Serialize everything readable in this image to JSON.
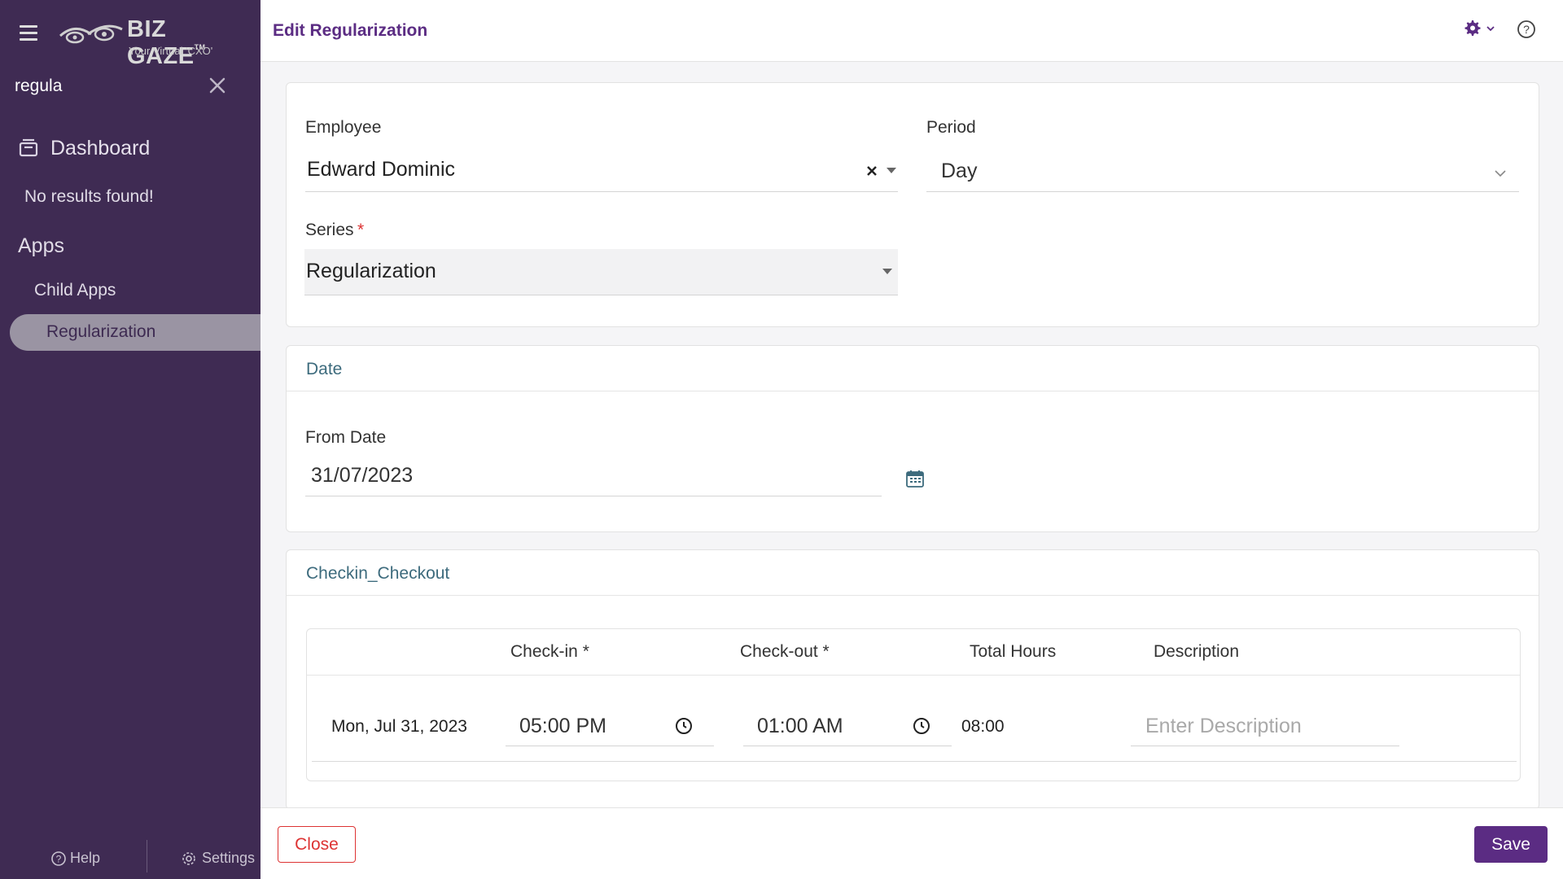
{
  "sidebar": {
    "logo": {
      "brand": "BIZ GAZE",
      "tm": "TM",
      "tagline": "Your Virtual 'CXO'"
    },
    "search": {
      "value": "regula"
    },
    "dashboard_label": "Dashboard",
    "no_results": "No results found!",
    "apps_heading": "Apps",
    "child_apps_label": "Child Apps",
    "active_item_label": "Regularization",
    "help_label": "Help",
    "settings_label": "Settings"
  },
  "header": {
    "title": "Edit Regularization"
  },
  "form": {
    "employee": {
      "label": "Employee",
      "value": "Edward Dominic"
    },
    "period": {
      "label": "Period",
      "value": "Day"
    },
    "series": {
      "label": "Series",
      "required_mark": "*",
      "value": "Regularization"
    }
  },
  "date_section": {
    "title": "Date",
    "from_date": {
      "label": "From Date",
      "value": "31/07/2023"
    }
  },
  "checkin_section": {
    "title": "Checkin_Checkout",
    "columns": [
      "Check-in *",
      "Check-out *",
      "Total Hours",
      "Description"
    ],
    "rows": [
      {
        "date": "Mon, Jul 31, 2023",
        "checkin": "05:00 PM",
        "checkout": "01:00 AM",
        "total_hours": "08:00",
        "description_placeholder": "Enter Description"
      }
    ]
  },
  "footer": {
    "close_label": "Close",
    "save_label": "Save"
  },
  "colors": {
    "sidebar_bg": "#3f2b53",
    "accent": "#5b2c83",
    "danger": "#d33333",
    "section_title": "#3d6b7d"
  }
}
